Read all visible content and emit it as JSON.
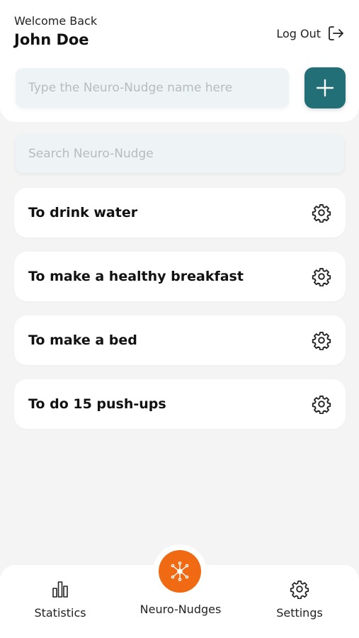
{
  "header": {
    "welcome_text": "Welcome Back",
    "user_name": "John Doe",
    "logout_label": "Log Out"
  },
  "create": {
    "name_placeholder": "Type the Neuro-Nudge name here",
    "name_value": "",
    "add_icon": "plus-icon"
  },
  "search": {
    "placeholder": "Search Neuro-Nudge",
    "value": ""
  },
  "nudges": [
    {
      "title": "To drink water",
      "icon": "gear-icon"
    },
    {
      "title": "To make a healthy breakfast",
      "icon": "gear-icon"
    },
    {
      "title": "To make a bed",
      "icon": "gear-icon"
    },
    {
      "title": "To do 15 push-ups",
      "icon": "gear-icon"
    }
  ],
  "bottom_nav": {
    "statistics_label": "Statistics",
    "nudges_label": "Neuro-Nudges",
    "settings_label": "Settings"
  },
  "colors": {
    "accent_teal": "#236f77",
    "accent_orange": "#f06a14",
    "input_bg": "#eef4f6",
    "page_bg": "#f4f4f4"
  }
}
